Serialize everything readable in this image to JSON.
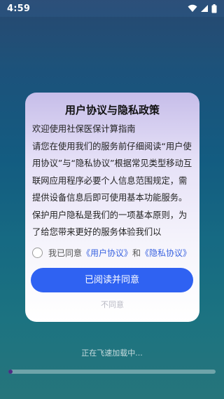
{
  "status_bar": {
    "time": "4:59",
    "icons": [
      "wifi-icon",
      "signal-icon",
      "battery-icon"
    ]
  },
  "dialog": {
    "title": "用户协议与隐私政策",
    "paragraph1": "欢迎使用社保医保计算指南",
    "paragraph2": "请您在使用我们的服务前仔细阅读“用户使用协议”与“隐私协议”根据常见类型移动互联网应用程序必要个人信息范围规定，需提供设备信息后即可使用基本功能服务。保护用户隐私是我们的一项基本原则，为了给您带来更好的服务体验我们以",
    "consent_prefix": "我已同意",
    "user_agreement_link": "《用户协议》",
    "consent_and": "和",
    "privacy_link": "《隐私协议》",
    "agree_button": "已阅读并同意",
    "disagree_button": "不同意"
  },
  "loading": {
    "text": "正在飞速加载中...",
    "progress": 0.02
  },
  "colors": {
    "accent": "#2f62f2",
    "link": "#3a63e0",
    "progress": "#4d2c83"
  }
}
